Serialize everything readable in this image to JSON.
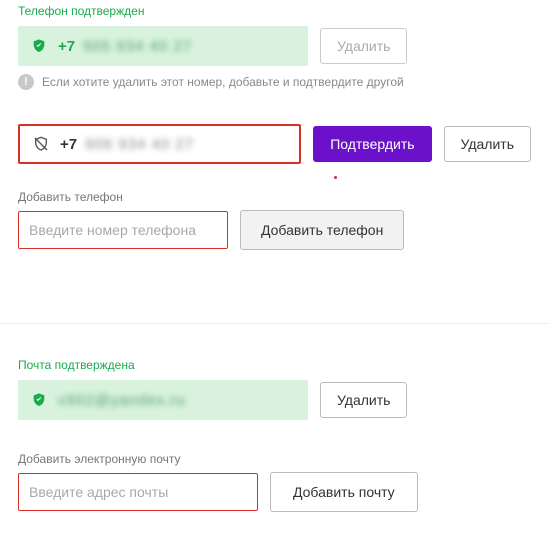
{
  "colors": {
    "green": "#1aab4a",
    "red": "#d93025",
    "purple": "#6b11c9"
  },
  "phone_confirmed": {
    "status": "Телефон подтвержден",
    "prefix": "+7",
    "masked": "905 934 40 27",
    "delete_btn": "Удалить",
    "hint": "Если хотите удалить этот номер, добавьте и подтвердите другой"
  },
  "phone_unconfirmed": {
    "prefix": "+7",
    "masked": "906 934 40 27",
    "confirm_btn": "Подтвердить",
    "delete_btn": "Удалить"
  },
  "add_phone": {
    "label": "Добавить телефон",
    "placeholder": "Введите номер телефона",
    "button": "Добавить телефон"
  },
  "email_confirmed": {
    "status": "Почта подтверждена",
    "masked": "v902@yandex.ru",
    "delete_btn": "Удалить"
  },
  "add_email": {
    "label": "Добавить электронную почту",
    "placeholder": "Введите адрес почты",
    "button": "Добавить почту"
  }
}
